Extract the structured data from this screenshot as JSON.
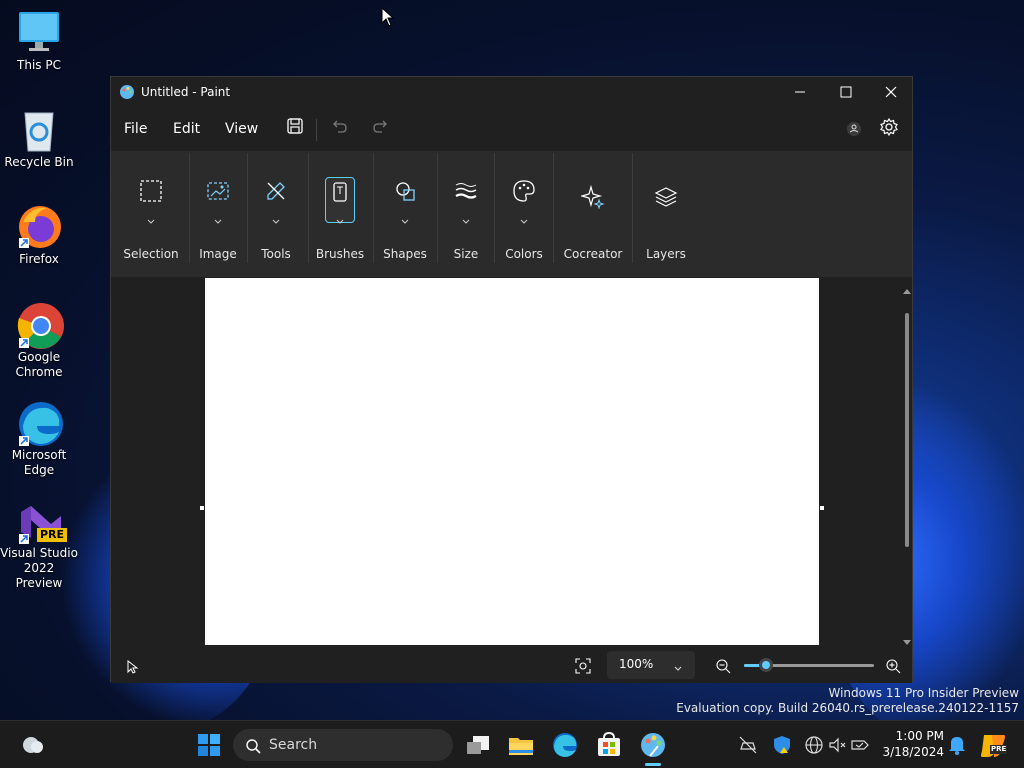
{
  "desktop": {
    "icons": [
      {
        "label": "This PC"
      },
      {
        "label": "Recycle Bin"
      },
      {
        "label": "Firefox"
      },
      {
        "label": "Google Chrome"
      },
      {
        "label": "Microsoft Edge"
      },
      {
        "label": "Visual Studio 2022 Preview",
        "badge": "PRE"
      }
    ]
  },
  "window": {
    "title": "Untitled - Paint",
    "menu": [
      "File",
      "Edit",
      "View"
    ],
    "ribbon_groups": [
      "Selection",
      "Image",
      "Tools",
      "Brushes",
      "Shapes",
      "Size",
      "Colors",
      "Cocreator",
      "Layers"
    ],
    "zoom": "100%"
  },
  "watermark": {
    "line1": "Windows 11 Pro Insider Preview",
    "line2": "Evaluation copy. Build 26040.rs_prerelease.240122-1157"
  },
  "taskbar": {
    "search_placeholder": "Search",
    "time": "1:00 PM",
    "date": "3/18/2024",
    "notification_badge": "PRE"
  },
  "colors": {
    "accent": "#60cdff",
    "window_bg": "#202020",
    "ribbon_bg": "#2b2b2b",
    "taskbar_bg": "#1c1c1c"
  }
}
